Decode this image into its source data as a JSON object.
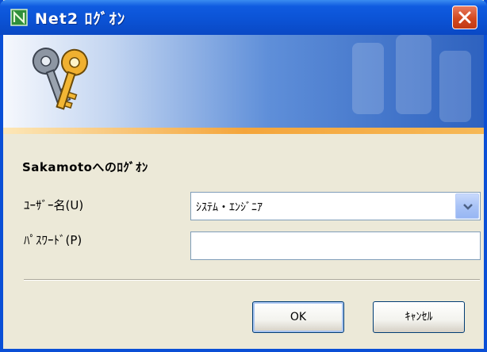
{
  "window": {
    "title": "Net2 ﾛｸﾞｵﾝ",
    "app_icon": "net2-icon",
    "close_icon": "close-icon"
  },
  "banner": {
    "icon": "keys-icon",
    "watermark": "keys-watermark"
  },
  "form": {
    "heading": "Sakamotoへのﾛｸﾞｵﾝ",
    "username_label": "ﾕｰｻﾞｰ名(U)",
    "username_value": "ｼｽﾃﾑ・ｴﾝｼﾞﾆｱ",
    "password_label": "ﾊﾟｽﾜｰﾄﾞ(P)",
    "password_value": ""
  },
  "buttons": {
    "ok": "OK",
    "cancel": "ｷｬﾝｾﾙ"
  },
  "colors": {
    "titlebar": "#0b52d4",
    "close": "#d2491f",
    "accent_stripe": "#f4a53b",
    "dialog_bg": "#ece9d8"
  }
}
